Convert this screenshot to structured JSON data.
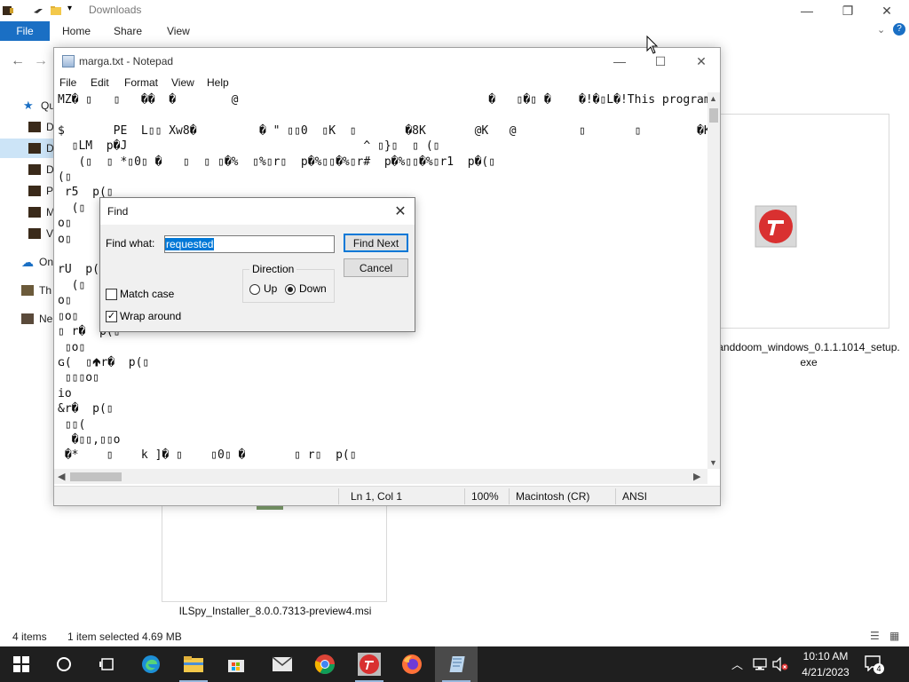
{
  "explorer": {
    "title": "Downloads",
    "ribbon": {
      "file": "File",
      "home": "Home",
      "share": "Share",
      "view": "View"
    },
    "nav": [
      {
        "label": "Qu"
      },
      {
        "label": "D"
      },
      {
        "label": "D"
      },
      {
        "label": "D"
      },
      {
        "label": "P"
      },
      {
        "label": "M"
      },
      {
        "label": "V"
      },
      {
        "label": "On"
      },
      {
        "label": "Th"
      },
      {
        "label": "Ne"
      }
    ],
    "files": {
      "setup_name_line1": "anddoom_windows_0.1.1.1014_setup.",
      "setup_name_line2": "exe",
      "msi_name": "ILSpy_Installer_8.0.0.7313-preview4.msi"
    },
    "status": {
      "items": "4 items",
      "selected": "1 item selected  4.69 MB"
    }
  },
  "notepad": {
    "title": "marga.txt - Notepad",
    "menu": {
      "file": "File",
      "edit": "Edit",
      "format": "Format",
      "view": "View",
      "help": "Help"
    },
    "content": "MZ� ▯   ▯   ��  �        @                                    �   ▯�▯ �    �!�▯L�!This program\n\n$       PE  L▯▯ Xw8�         � \" ▯▯0  ▯K  ▯       �8K       @K   @         ▯       ▯        �K\n  ▯LM  p�J                                  ^ ▯}▯  ▯ (▯\n   (▯  ▯ *▯0▯ �   ▯  ▯ ▯�%  ▯%▯r▯  p�%▯▯�%▯r#  p�%▯▯�%▯r1  p�(▯\n(▯\n r5  p(▯\n  (▯\no▯\no▯\n\nrU  p(▯\n  (▯\no▯\n▯o▯\n▯ r�  p(▯\n ▯o▯\nɢ(  ▯🢁r�  p(▯\n ▯▯▯o▯\nio\n&r�  p(▯\n ▯▯(\n  �▯▯,▯▯o\n �*    ▯    k ]� ▯    ▯0▯ �       ▯ r▯  p(▯",
    "status": {
      "position": "Ln 1, Col 1",
      "zoom": "100%",
      "eol": "Macintosh (CR)",
      "encoding": "ANSI"
    }
  },
  "find": {
    "title": "Find",
    "find_what_label": "Find what:",
    "find_what_value": "requested",
    "find_next": "Find Next",
    "cancel": "Cancel",
    "direction_label": "Direction",
    "up_label": "Up",
    "down_label": "Down",
    "direction_selected": "Down",
    "match_case_label": "Match case",
    "match_case_checked": false,
    "wrap_around_label": "Wrap around",
    "wrap_around_checked": true
  },
  "taskbar": {
    "time": "10:10 AM",
    "date": "4/21/2023",
    "notification_count": "4"
  },
  "colors": {
    "accent": "#0078d7",
    "file_tab": "#1a6fc4",
    "taskbar": "#1f1f1f"
  }
}
